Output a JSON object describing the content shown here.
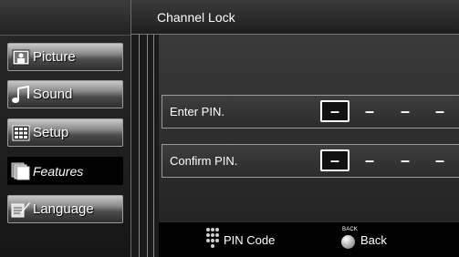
{
  "header": {
    "title": "Channel Lock"
  },
  "sidebar": {
    "items": [
      {
        "label": "Picture",
        "icon": "picture-icon",
        "active": false
      },
      {
        "label": "Sound",
        "icon": "music-note-icon",
        "active": false
      },
      {
        "label": "Setup",
        "icon": "setup-grid-icon",
        "active": false
      },
      {
        "label": "Features",
        "icon": "features-stack-icon",
        "active": true
      },
      {
        "label": "Language",
        "icon": "language-icon",
        "active": false
      }
    ]
  },
  "form": {
    "enter_pin": {
      "label": "Enter PIN.",
      "digits": [
        "–",
        "–",
        "–",
        "–"
      ]
    },
    "confirm_pin": {
      "label": "Confirm PIN.",
      "digits": [
        "–",
        "–",
        "–",
        "–"
      ]
    }
  },
  "footer": {
    "pin_code": {
      "label": "PIN Code",
      "icon": "keypad-icon"
    },
    "back": {
      "label": "Back",
      "caption": "BACK",
      "icon": "back-button-icon"
    }
  },
  "colors": {
    "background": "#000000",
    "panel": "#2e2e2e",
    "text": "#ffffff"
  }
}
